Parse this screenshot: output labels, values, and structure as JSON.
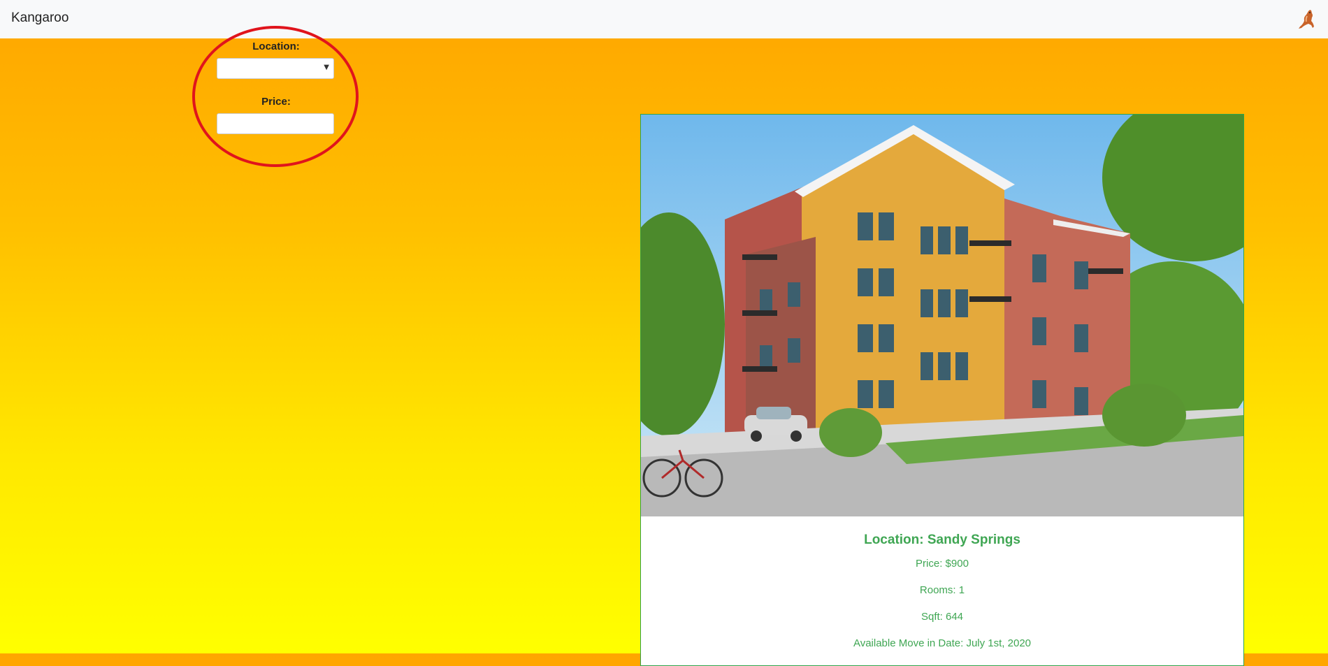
{
  "navbar": {
    "brand": "Kangaroo",
    "logo_icon": "kangaroo-icon"
  },
  "filters": {
    "location_label": "Location:",
    "location_value": "",
    "price_label": "Price:",
    "price_value": ""
  },
  "listing": {
    "title": "Location: Sandy Springs",
    "price": "Price: $900",
    "rooms": "Rooms: 1",
    "sqft": "Sqft: 644",
    "move_in": "Available Move in Date: July 1st, 2020",
    "image_icon": "apartment-building-photo"
  },
  "colors": {
    "accent_green": "#3fa653",
    "annotation_red": "#e0141c",
    "gradient_top": "#ffa500",
    "gradient_bottom": "#ffff00"
  }
}
